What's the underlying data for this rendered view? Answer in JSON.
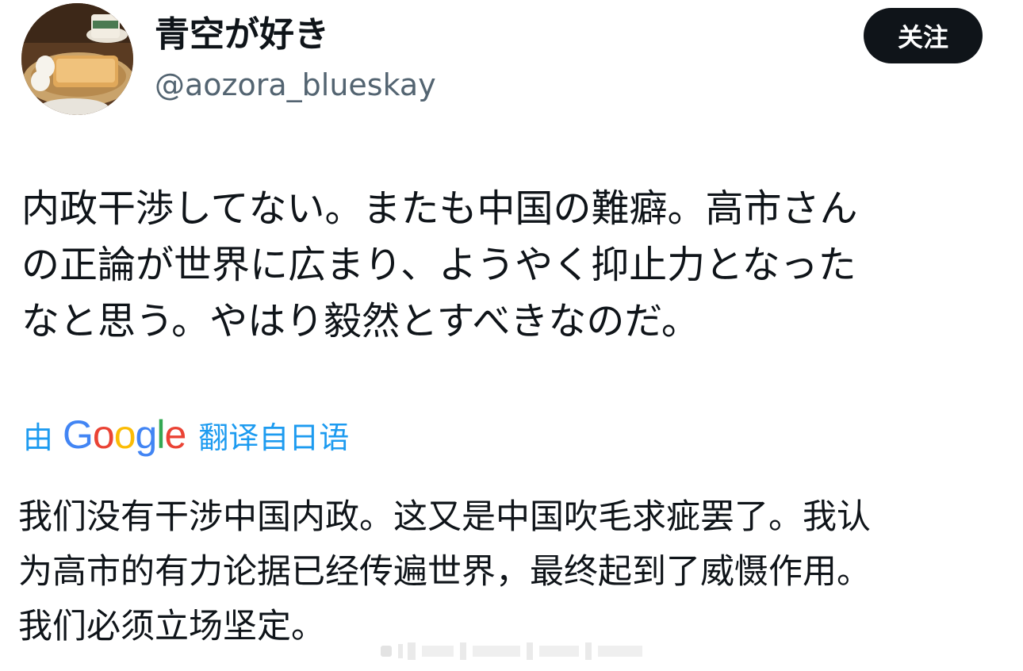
{
  "author": {
    "display_name": "青空が好き",
    "handle": "@aozora_blueskay"
  },
  "follow_button": {
    "label": "关注"
  },
  "tweet": {
    "lines": [
      "内政干渉してない。またも中国の難癖。高市さん",
      "の正論が世界に広まり、ようやく抑止力となった",
      "なと思う。やはり毅然とすべきなのだ。"
    ]
  },
  "translation": {
    "by_label": "由",
    "provider": "Google",
    "provider_letters": [
      "G",
      "o",
      "o",
      "g",
      "l",
      "e"
    ],
    "from_label": "翻译自日语",
    "lines": [
      "我们没有干涉中国内政。这又是中国吹毛求疵罢了。我认",
      "为高市的有力论据已经传遍世界，最终起到了威慑作用。",
      "我们必须立场坚定。"
    ]
  },
  "colors": {
    "link_blue": "#1d9bf0",
    "text": "#0f1419",
    "muted": "#536471",
    "google_blue": "#4285f4",
    "google_red": "#ea4335",
    "google_yellow": "#fbbc05",
    "google_green": "#34a853"
  },
  "icons": {
    "avatar": "avatar-photo-toast-coffee-icon"
  }
}
